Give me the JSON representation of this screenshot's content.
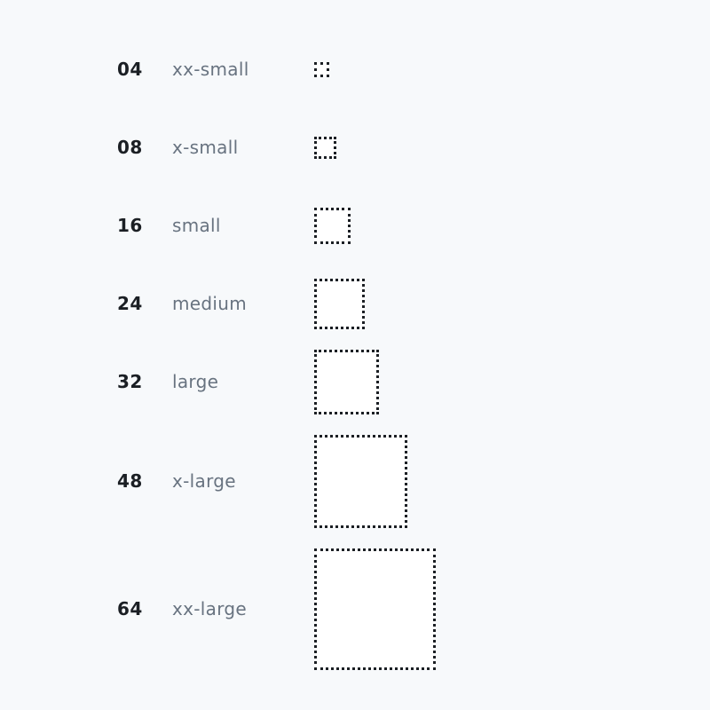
{
  "spacing_scale": {
    "items": [
      {
        "value": "04",
        "name": "xx-small"
      },
      {
        "value": "08",
        "name": "x-small"
      },
      {
        "value": "16",
        "name": "small"
      },
      {
        "value": "24",
        "name": "medium"
      },
      {
        "value": "32",
        "name": "large"
      },
      {
        "value": "48",
        "name": "x-large"
      },
      {
        "value": "64",
        "name": "xx-large"
      }
    ]
  }
}
